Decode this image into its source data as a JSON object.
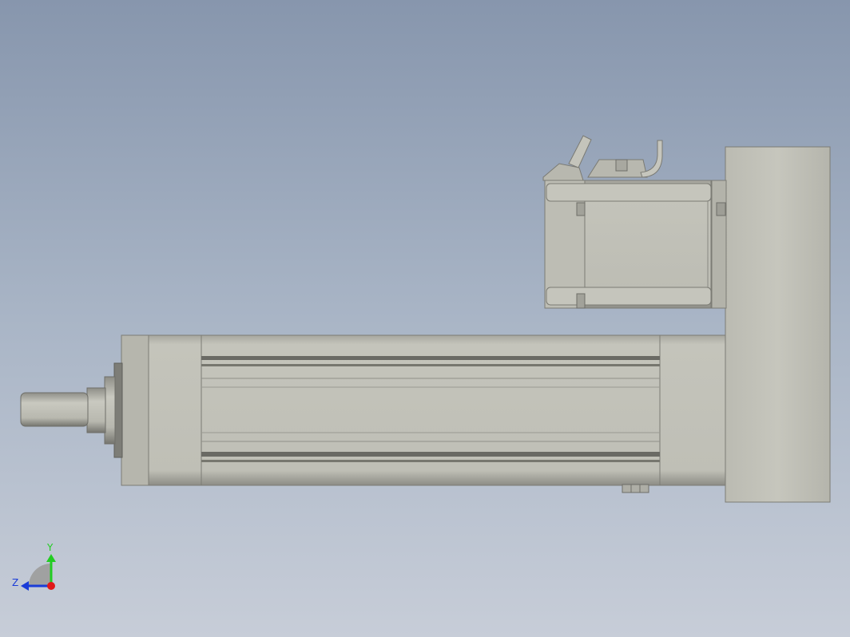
{
  "viewport": {
    "background_top": "#8796ad",
    "background_bottom": "#c7cdd8"
  },
  "model": {
    "part_color": "#c2c2b8",
    "part_shadow": "#8e8e86",
    "groove_color": "#6a6a64"
  },
  "triad": {
    "x_label": "",
    "y_label": "Y",
    "z_label": "Z",
    "y_color": "#22cc22",
    "z_color": "#1a3cd8",
    "origin_color": "#e01818"
  }
}
